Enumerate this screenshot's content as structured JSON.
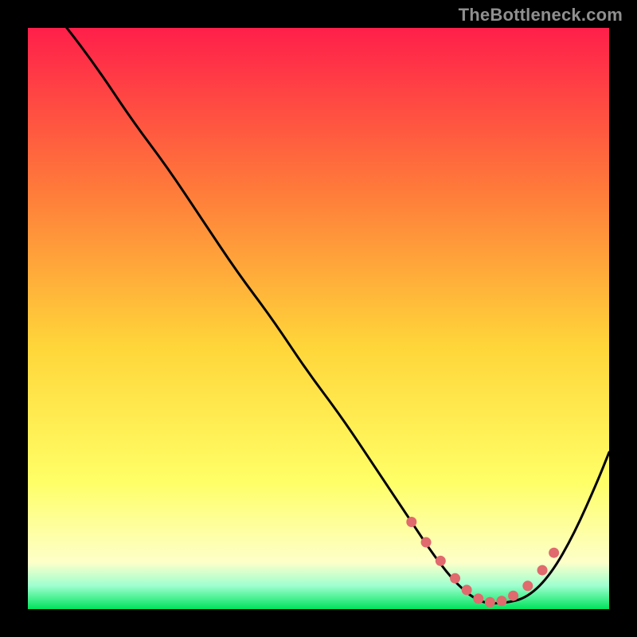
{
  "watermark": "TheBottleneck.com",
  "colors": {
    "top": "#ff1f4a",
    "orange": "#ff7b3a",
    "yellow_mid": "#ffd63a",
    "yellow_light": "#ffff66",
    "pale": "#fdffc9",
    "green": "#00e35b",
    "curve": "#000000",
    "dots": "#e06a6e"
  },
  "chart_data": {
    "type": "line",
    "title": "",
    "xlabel": "",
    "ylabel": "",
    "xlim": [
      0,
      100
    ],
    "ylim": [
      0,
      100
    ],
    "grid": false,
    "notes": "Axes unlabeled; values are relative (0-100) estimated from pixel positions. y=0 at bottom, y=100 at top. Curve represents bottleneck percentage; minimum (best match) occurs around x≈75-85.",
    "series": [
      {
        "name": "bottleneck-curve",
        "x": [
          0,
          6,
          12,
          18,
          24,
          30,
          36,
          42,
          48,
          54,
          60,
          66,
          70,
          74,
          78,
          82,
          86,
          90,
          94,
          98,
          100
        ],
        "y": [
          108,
          101,
          93,
          84,
          76,
          67,
          58,
          50,
          41,
          33,
          24,
          15,
          9,
          4,
          1,
          1,
          2,
          6,
          13,
          22,
          27
        ]
      }
    ],
    "highlight_points": {
      "name": "valley-dots",
      "x": [
        66,
        68.5,
        71,
        73.5,
        75.5,
        77.5,
        79.5,
        81.5,
        83.5,
        86,
        88.5,
        90.5
      ],
      "y": [
        15,
        11.5,
        8.3,
        5.3,
        3.3,
        1.8,
        1.2,
        1.4,
        2.3,
        4.0,
        6.7,
        9.7
      ]
    }
  }
}
